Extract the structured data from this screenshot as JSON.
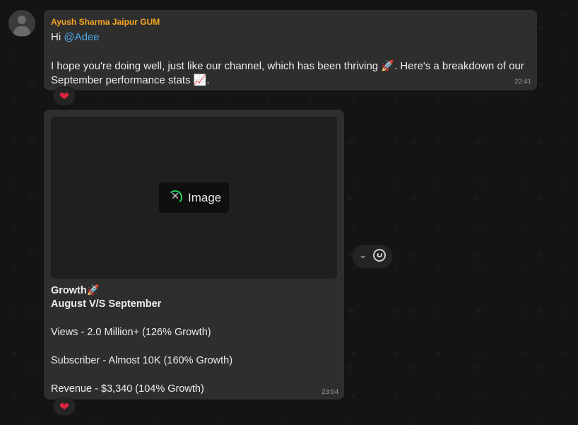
{
  "message1": {
    "sender": "Ayush Sharma Jaipur GUM",
    "greeting_prefix": "Hi ",
    "mention": "@Adee",
    "body_line1": "I hope you're doing well, just like our channel, which has been thriving 🚀. Here's a breakdown of our",
    "body_line2": "September performance stats 📈.",
    "time": "22:41",
    "reaction": "❤"
  },
  "message2": {
    "image_label": "Image",
    "caption": {
      "title": "Growth🚀",
      "subtitle": "August V/S September",
      "views": "Views - 2.0 Million+ (126% Growth)",
      "subscriber": "Subscriber - Almost 10K (160% Growth)",
      "revenue": "Revenue - $3,340 (104% Growth)"
    },
    "time": "23:04",
    "reaction": "❤"
  },
  "colors": {
    "sender": "#f5a623",
    "mention": "#4fa9e6",
    "bubble": "#2e2e2e",
    "spinner": "#25d366"
  },
  "icons": [
    "default-avatar-icon",
    "heart-reaction-icon",
    "close-icon",
    "chevron-down-icon",
    "emoji-smiley-icon"
  ]
}
